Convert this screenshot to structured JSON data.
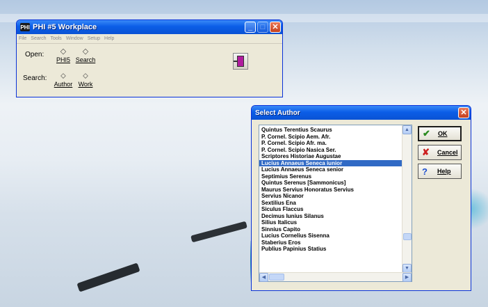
{
  "workplace": {
    "title": "PHI #5 Workplace",
    "logo_text": "PHI",
    "menus": [
      "File",
      "Search",
      "Tools",
      "Window",
      "Setup",
      "Help"
    ],
    "open_label": "Open:",
    "search_label": "Search:",
    "open_phi5": "PHI5",
    "open_search": "Search",
    "search_author": "Author",
    "search_work": "Work"
  },
  "dialog": {
    "title": "Select Author",
    "authors": [
      "Quintus Terentius Scaurus",
      "P. Cornel. Scipio Aem. Afr.",
      "P. Cornel. Scipio Afr. ma.",
      "P. Cornel. Scipio Nasica Ser.",
      "Scriptores Historiae Augustae",
      "Lucius Annaeus Seneca iunior",
      "Lucius Annaeus Seneca senior",
      "Septimius Serenus",
      "Quintus Serenus [Sammonicus]",
      "Maurus Servius Honoratus Servius",
      "Servius Nicanor",
      "Sextilius Ena",
      "Siculus Flaccus",
      "Decimus Iunius Silanus",
      "Silius Italicus",
      "Sinnius Capito",
      "Lucius Cornelius Sisenna",
      "Staberius Eros",
      "Publius Papinius Statius"
    ],
    "selected_index": 5,
    "ok_label": "OK",
    "cancel_label": "Cancel",
    "help_label": "Help"
  }
}
